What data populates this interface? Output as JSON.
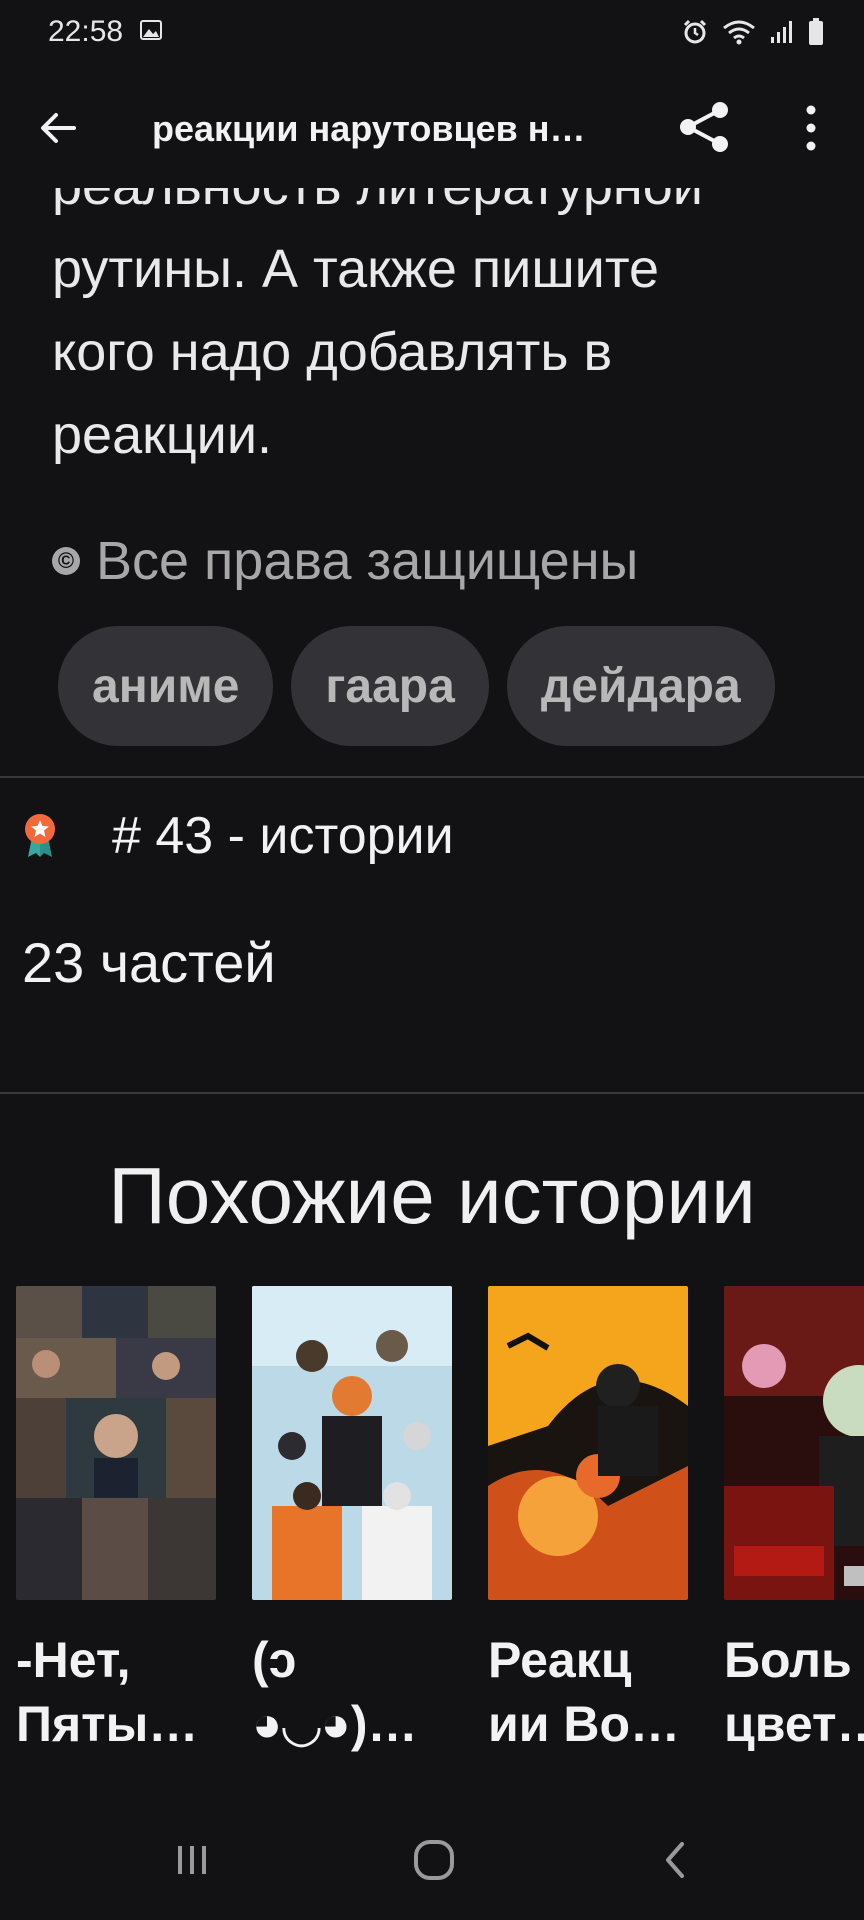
{
  "status_bar": {
    "time": "22:58"
  },
  "app_bar": {
    "title": "реакции нарутовцев н…"
  },
  "description": {
    "lines": [
      "реальность литературной",
      "рутины. А также пишите",
      "кого надо добавлять в",
      "реакции."
    ]
  },
  "copyright": {
    "symbol": "©",
    "text": "Все права защищены"
  },
  "tags": [
    "аниме",
    "гаара",
    "дейдара"
  ],
  "ranking": {
    "text": "# 43 - истории"
  },
  "parts": {
    "text": "23 частей"
  },
  "similar": {
    "heading": "Похожие истории",
    "stories": [
      {
        "title": "-Нет,\nПяты…"
      },
      {
        "title": "(ↄ\n◕◡◕)…"
      },
      {
        "title": "Реакц\nии Во…"
      },
      {
        "title": "Боль\nцвет…"
      }
    ]
  },
  "colors": {
    "background": "#121114",
    "tag_background": "#333236",
    "rank_badge": "#f26a3c"
  },
  "icons": {
    "back": "arrow-left-icon",
    "share": "share-icon",
    "more": "more-vertical-icon",
    "rank": "award-ribbon-icon"
  }
}
